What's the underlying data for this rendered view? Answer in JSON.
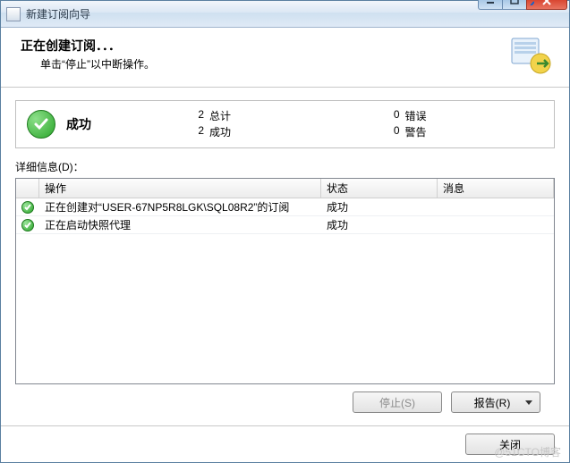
{
  "window": {
    "title": "新建订阅向导"
  },
  "header": {
    "title": "正在创建订阅．．．",
    "subtitle": "单击“停止”以中断操作。"
  },
  "summary": {
    "status_label": "成功",
    "stats": {
      "total_label": "总计",
      "total_value": "2",
      "success_label": "成功",
      "success_value": "2",
      "error_label": "错误",
      "error_value": "0",
      "warning_label": "警告",
      "warning_value": "0"
    }
  },
  "details": {
    "label": "详细信息(D)：",
    "columns": {
      "op": "操作",
      "status": "状态",
      "msg": "消息"
    },
    "rows": [
      {
        "icon": "check",
        "op": "正在创建对“USER-67NP5R8LGK\\SQL08R2”的订阅",
        "status": "成功",
        "msg": ""
      },
      {
        "icon": "check",
        "op": "正在启动快照代理",
        "status": "成功",
        "msg": ""
      }
    ]
  },
  "buttons": {
    "stop": "停止(S)",
    "report": "报告(R)",
    "close": "关闭"
  },
  "watermark": "@51CTO博客"
}
